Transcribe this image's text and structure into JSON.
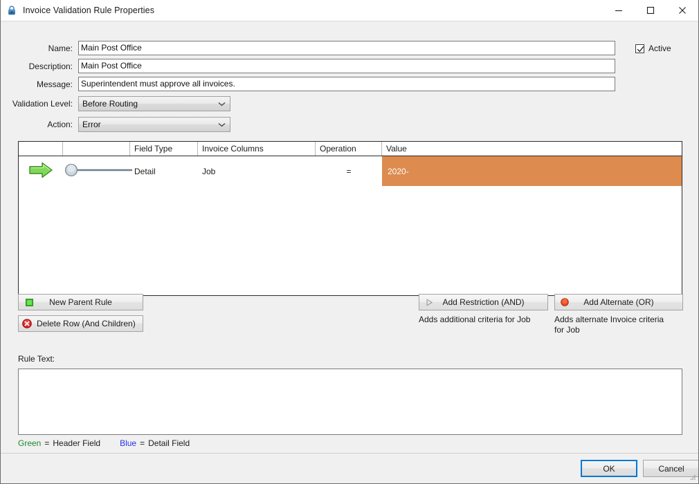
{
  "window": {
    "title": "Invoice Validation Rule Properties",
    "icon": "lock-icon",
    "controls": {
      "minimize": "minimize-icon",
      "maximize": "maximize-icon",
      "close": "close-icon"
    }
  },
  "form": {
    "name": {
      "label": "Name:",
      "value": "Main Post Office"
    },
    "description": {
      "label": "Description:",
      "value": "Main Post Office"
    },
    "message": {
      "label": "Message:",
      "value": "Superintendent must approve all invoices."
    },
    "validation_level": {
      "label": "Validation Level:",
      "value": "Before Routing"
    },
    "action": {
      "label": "Action:",
      "value": "Error"
    },
    "active": {
      "label": "Active",
      "checked": true
    }
  },
  "grid": {
    "columns": [
      "",
      "",
      "Field Type",
      "Invoice Columns",
      "Operation",
      "Value"
    ],
    "rows": [
      {
        "marker": "green-arrow-icon",
        "connector": "node-connector-icon",
        "field_type": "Detail",
        "invoice_columns": "Job",
        "operation": "=",
        "value": "2020-",
        "value_highlight": "#dd8b4f"
      }
    ]
  },
  "actions": {
    "new_parent_rule": {
      "label": "New Parent Rule",
      "icon": "green-square-icon"
    },
    "delete_row": {
      "label": "Delete Row (And Children)",
      "icon": "red-delete-icon"
    },
    "add_restriction": {
      "label": "Add Restriction (AND)",
      "icon": "gray-triangle-icon",
      "help": "Adds additional criteria for Job"
    },
    "add_alternate": {
      "label": "Add Alternate (OR)",
      "icon": "orange-circle-icon",
      "help": "Adds alternate Invoice criteria for Job"
    }
  },
  "rule_text": {
    "label": "Rule Text:",
    "value": ""
  },
  "legend": {
    "green_word": "Green",
    "green_eq": "=",
    "green_text": "Header Field",
    "blue_word": "Blue",
    "blue_eq": "=",
    "blue_text": "Detail Field"
  },
  "footer": {
    "ok": "OK",
    "cancel": "Cancel"
  },
  "colors": {
    "accent": "#0078d7",
    "value_highlight": "#dd8b4f",
    "legend_green": "#1f8a2f",
    "legend_blue": "#2431e8",
    "window_bg": "#f0f0f0"
  }
}
